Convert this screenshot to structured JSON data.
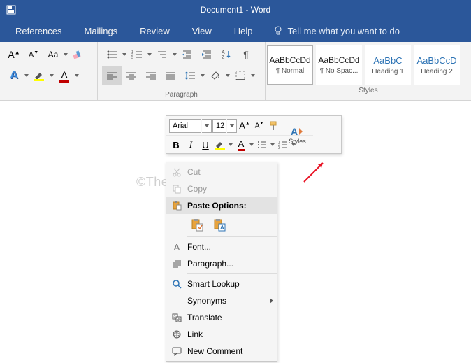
{
  "titlebar": {
    "title": "Document1  -  Word"
  },
  "menu": {
    "references": "References",
    "mailings": "Mailings",
    "review": "Review",
    "view": "View",
    "help": "Help",
    "tellme": "Tell me what you want to do"
  },
  "ribbon": {
    "paragraph_label": "Paragraph",
    "styles_label": "Styles"
  },
  "styles": [
    {
      "preview": "AaBbCcDd",
      "name": "¶ Normal",
      "selected": true,
      "blue": false
    },
    {
      "preview": "AaBbCcDd",
      "name": "¶ No Spac...",
      "selected": false,
      "blue": false
    },
    {
      "preview": "AaBbC",
      "name": "Heading 1",
      "selected": false,
      "blue": true
    },
    {
      "preview": "AaBbCcD",
      "name": "Heading 2",
      "selected": false,
      "blue": true
    }
  ],
  "minitoolbar": {
    "font": "Arial",
    "size": "12",
    "styles_label": "Styles",
    "bold": "B",
    "italic": "I",
    "underline": "U"
  },
  "watermark": "©TheGeekPage.com",
  "context_menu": {
    "cut": "Cut",
    "copy": "Copy",
    "paste_options": "Paste Options:",
    "font": "Font...",
    "paragraph": "Paragraph...",
    "smart_lookup": "Smart Lookup",
    "synonyms": "Synonyms",
    "translate": "Translate",
    "link": "Link",
    "new_comment": "New Comment"
  }
}
